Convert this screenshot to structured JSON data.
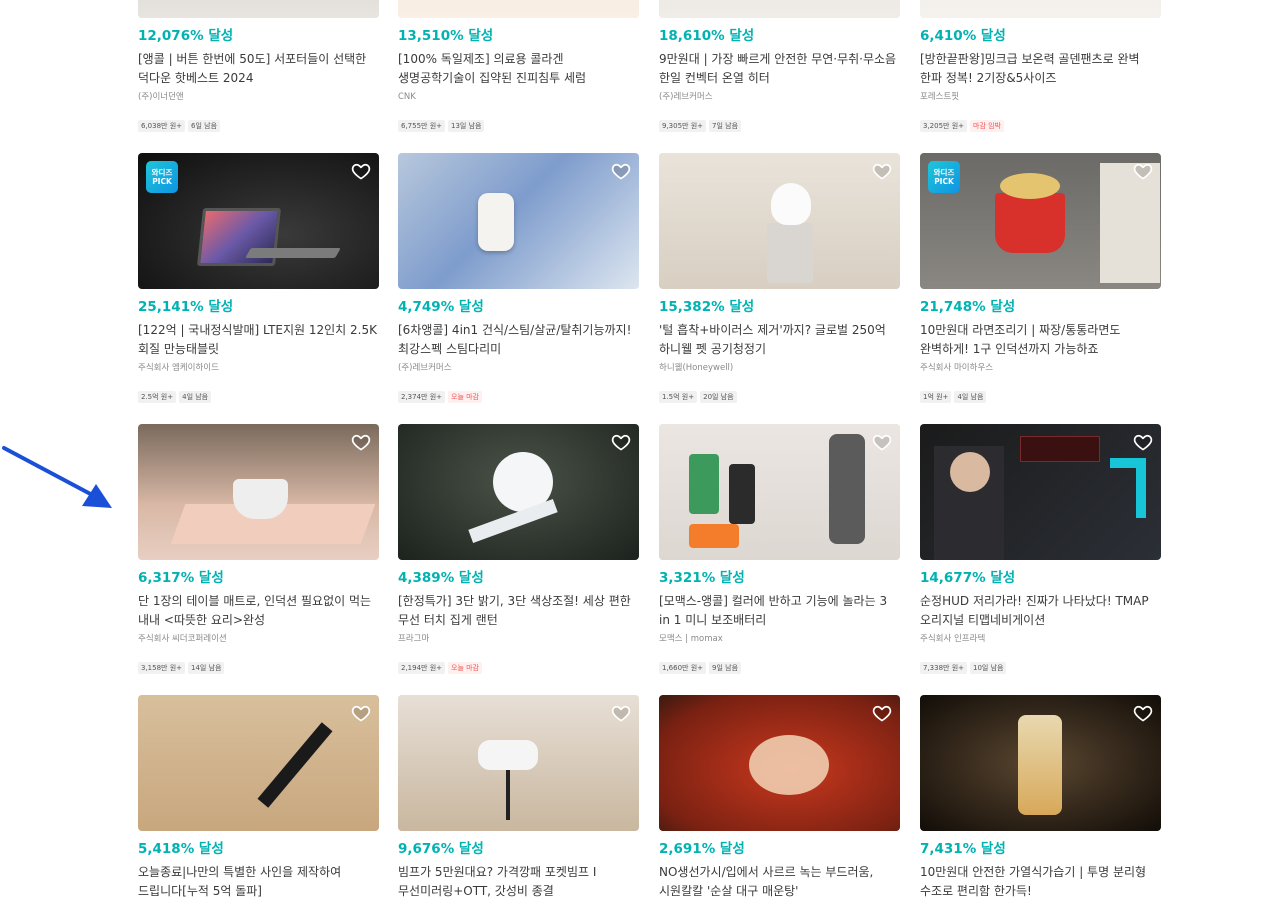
{
  "rows": [
    [
      {
        "rate": "12,076% 달성",
        "title": "[앵콜 | 버튼 한번에 50도] 서포터들이 선택한 덕다운 핫베스트 2024",
        "maker": "(주)이너던앤",
        "tags": [
          "6,038만 원+",
          "6일 남음"
        ],
        "warn": [
          false,
          false
        ],
        "pick": false,
        "image": "down vest"
      },
      {
        "rate": "13,510% 달성",
        "title": "[100% 독일제조] 의료용 콜라겐 생명공학기술이 집약된 진피침투 세럼",
        "maker": "CNK",
        "tags": [
          "6,755만 원+",
          "13일 남음"
        ],
        "warn": [
          false,
          false
        ],
        "pick": false,
        "image": "serum"
      },
      {
        "rate": "18,610% 달성",
        "title": "9만원대 | 가장 빠르게 안전한 무연·무취·무소음 한일 컨벡터 온열 히터",
        "maker": "(주)레브커머스",
        "tags": [
          "9,305만 원+",
          "7일 남음"
        ],
        "warn": [
          false,
          false
        ],
        "pick": false,
        "image": "heater"
      },
      {
        "rate": "6,410% 달성",
        "title": "[방한끝판왕]밍크급 보온력 골덴팬츠로 완벽 한파 정복! 2기장&5사이즈",
        "maker": "포레스트핏",
        "tags": [
          "3,205만 원+",
          "마감 임박"
        ],
        "warn": [
          false,
          true
        ],
        "pick": false,
        "image": "pants"
      }
    ],
    [
      {
        "rate": "25,141% 달성",
        "title": "[122억 | 국내정식발매] LTE지원 12인치 2.5K 회질 만능태블릿",
        "maker": "주식회사 엠케이하이드",
        "tags": [
          "2.5억 원+",
          "4일 남음"
        ],
        "warn": [
          false,
          false
        ],
        "pick": true,
        "image": "tablet"
      },
      {
        "rate": "4,749% 달성",
        "title": "[6차앵콜] 4in1 건식/스팀/살균/탈취기능까지! 최강스펙 스팀다리미",
        "maker": "(주)레브커머스",
        "tags": [
          "2,374만 원+",
          "오늘 마감"
        ],
        "warn": [
          false,
          true
        ],
        "pick": false,
        "image": "steamer"
      },
      {
        "rate": "15,382% 달성",
        "title": "'털 흡착+바이러스 제거'까지? 글로벌 250억 하니웰 펫 공기청정기",
        "maker": "하니웰(Honeywell)",
        "tags": [
          "1.5억 원+",
          "20일 남음"
        ],
        "warn": [
          false,
          false
        ],
        "pick": false,
        "image": "air purifier cat"
      },
      {
        "rate": "21,748% 달성",
        "title": "10만원대 라면조리기 | 짜장/통통라면도 완벽하게! 1구 인덕션까지 가능하죠",
        "maker": "주식회사 마이하우스",
        "tags": [
          "1억 원+",
          "4일 남음"
        ],
        "warn": [
          false,
          false
        ],
        "pick": true,
        "image": "ramen cooker"
      }
    ],
    [
      {
        "rate": "6,317% 달성",
        "title": "단 1장의 테이블 매트로, 인덕션 필요없이 먹는 내내 <따뜻한 요리>완성",
        "maker": "주식회사 씨더코퍼레이션",
        "tags": [
          "3,158만 원+",
          "14일 남음"
        ],
        "warn": [
          false,
          false
        ],
        "pick": false,
        "image": "heating mat"
      },
      {
        "rate": "4,389% 달성",
        "title": "[한정특가] 3단 밝기, 3단 색상조절! 세상 편한 무선 터치 집게 랜턴",
        "maker": "프라그마",
        "tags": [
          "2,194만 원+",
          "오늘 마감"
        ],
        "warn": [
          false,
          true
        ],
        "pick": false,
        "image": "clip lamp"
      },
      {
        "rate": "3,321% 달성",
        "title": "[모맥스-앵콜] 컬러에 반하고 기능에 놀라는 3 in 1 미니 보조배터리",
        "maker": "모맥스 | momax",
        "tags": [
          "1,660만 원+",
          "9일 남음"
        ],
        "warn": [
          false,
          false
        ],
        "pick": false,
        "image": "power banks"
      },
      {
        "rate": "14,677% 달성",
        "title": "순정HUD 저리가라! 진짜가 나타났다! TMAP 오리지널 티맵네비게이션",
        "maker": "주식회사 인프라텍",
        "tags": [
          "7,338만 원+",
          "10일 남음"
        ],
        "warn": [
          false,
          false
        ],
        "pick": false,
        "image": "hud navigation"
      }
    ],
    [
      {
        "rate": "5,418% 달성",
        "title": "오늘종료|나만의 특별한 사인을 제작하여 드립니다[누적 5억 돌파]",
        "maker": "",
        "tags": [],
        "warn": [],
        "pick": false,
        "image": "signature pen"
      },
      {
        "rate": "9,676% 달성",
        "title": "빔프가 5만원대요? 가격깡패 포켓빔프 I 무선미러링+OTT, 갓성비 종결",
        "maker": "",
        "tags": [],
        "warn": [],
        "pick": false,
        "image": "projector"
      },
      {
        "rate": "2,691% 달성",
        "title": "NO생선가시/입에서 사르르 녹는 부드러움, 시원칼칼 '순살 대구 매운탕'",
        "maker": "",
        "tags": [],
        "warn": [],
        "pick": false,
        "image": "cod stew"
      },
      {
        "rate": "7,431% 달성",
        "title": "10만원대 안전한 가열식가습기 | 투명 분리형 수조로 편리함 한가득!",
        "maker": "",
        "tags": [],
        "warn": [],
        "pick": false,
        "image": "humidifier"
      }
    ]
  ],
  "pick_label": [
    "와디즈",
    "PICK"
  ],
  "icons": {
    "heart": "heart-outline-icon",
    "arrow": "pointer-arrow-icon"
  },
  "colors": {
    "accent": "#00b2b2",
    "warn": "#f25555",
    "arrow": "#1a4fd8"
  }
}
